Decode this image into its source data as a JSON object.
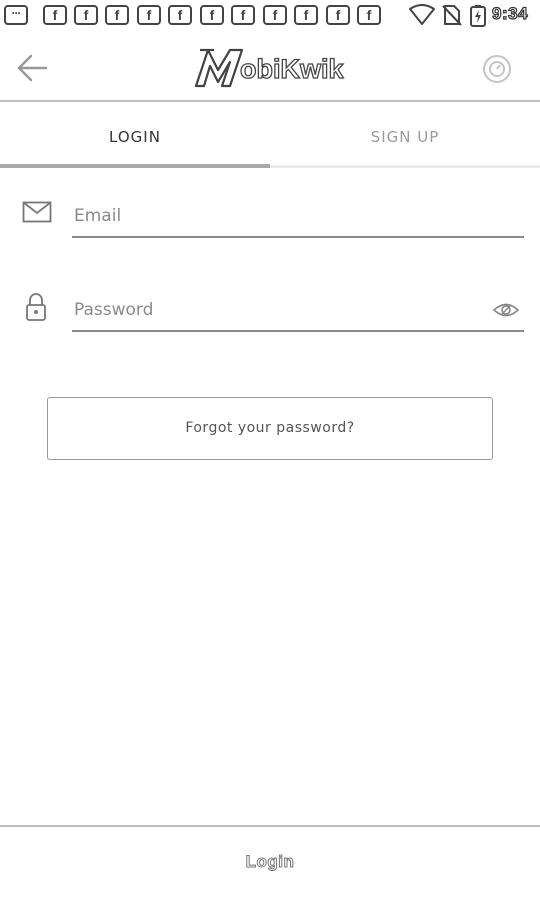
{
  "status_bar": {
    "notification_icons": [
      {
        "icon": "messages-icon",
        "glyph": "···"
      },
      {
        "icon": "facebook-icon",
        "glyph": "f"
      },
      {
        "icon": "facebook-icon",
        "glyph": "f"
      },
      {
        "icon": "facebook-icon",
        "glyph": "f"
      },
      {
        "icon": "facebook-icon",
        "glyph": "f"
      },
      {
        "icon": "facebook-icon",
        "glyph": "f"
      },
      {
        "icon": "facebook-icon",
        "glyph": "f"
      },
      {
        "icon": "facebook-icon",
        "glyph": "f"
      },
      {
        "icon": "facebook-icon",
        "glyph": "f"
      },
      {
        "icon": "facebook-icon",
        "glyph": "f"
      },
      {
        "icon": "facebook-icon",
        "glyph": "f"
      },
      {
        "icon": "facebook-icon",
        "glyph": "f"
      }
    ],
    "system_icons": [
      "wifi-icon",
      "no-sim-icon",
      "battery-charging-icon"
    ],
    "time": "9:34"
  },
  "app_bar": {
    "back_icon": "arrow-left-icon",
    "logo_text": "obiKwik",
    "help_icon": "help-circle-icon"
  },
  "tabs": [
    {
      "label": "LOGIN",
      "active": true
    },
    {
      "label": "SIGN UP",
      "active": false
    }
  ],
  "form": {
    "email": {
      "icon": "envelope-icon",
      "placeholder": "Email",
      "value": ""
    },
    "password": {
      "icon": "lock-icon",
      "placeholder": "Password",
      "value": "",
      "toggle_icon": "eye-icon"
    },
    "forgot_label": "Forgot your password?"
  },
  "bottom_bar": {
    "login_label": "Login"
  },
  "colors": {
    "text_dark": "#333333",
    "text_muted": "#9a9a9a",
    "divider": "#bdbdbd",
    "field_underline": "#8a8a8a"
  }
}
